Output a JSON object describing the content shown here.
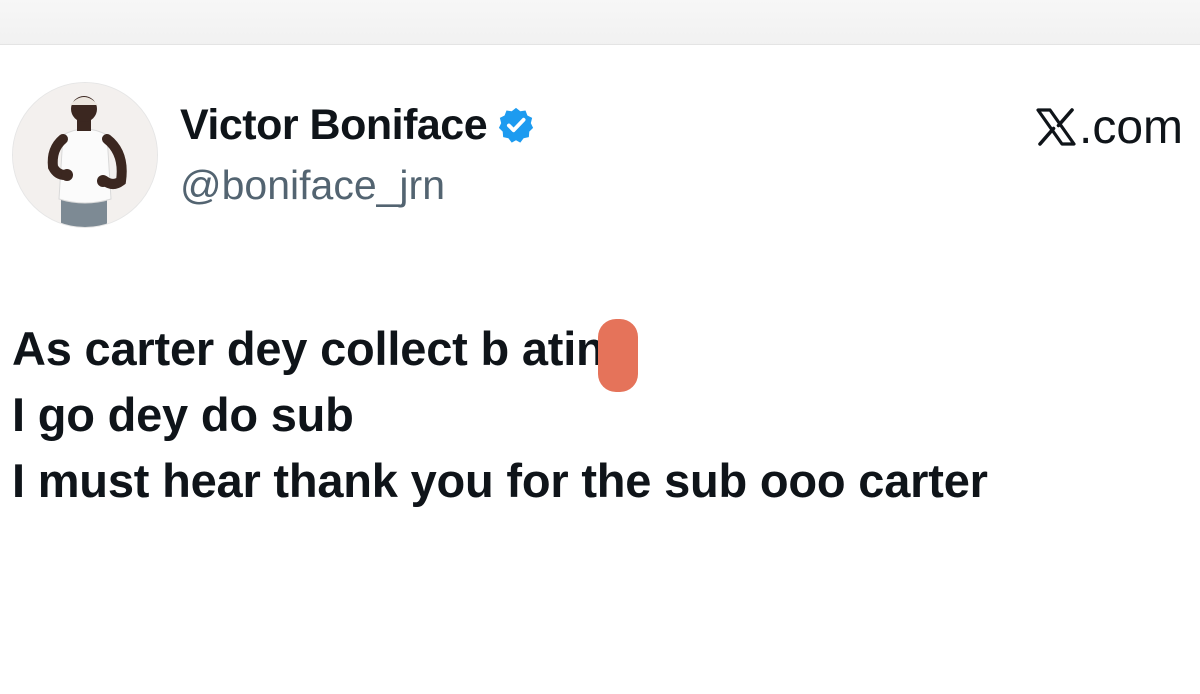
{
  "author": {
    "display_name": "Victor Boniface",
    "handle": "@boniface_jrn",
    "verified": true
  },
  "brand": {
    "label": ".com",
    "logo_icon": "x-logo-icon"
  },
  "tweet": {
    "lines": [
      "As carter dey collect b  ating",
      "I go dey do sub",
      "I must hear thank you for the sub ooo carter"
    ]
  },
  "colors": {
    "text": "#0f1419",
    "handle": "#536471",
    "verified_badge": "#1d9bf0",
    "redaction_mark": "#e5735a"
  }
}
